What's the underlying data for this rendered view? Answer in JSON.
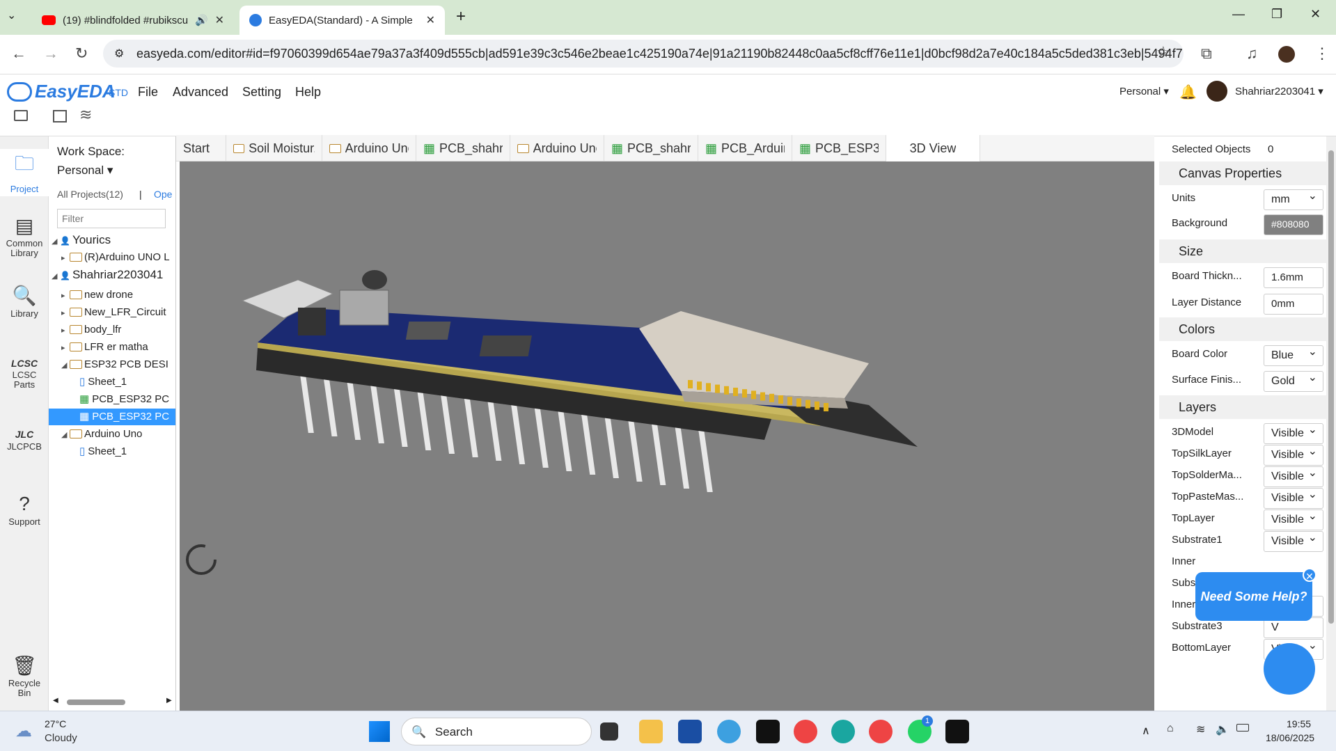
{
  "browser": {
    "tabs": [
      {
        "title": "(19) #blindfolded #rubikscu",
        "active": false
      },
      {
        "title": "EasyEDA(Standard) - A Simple a",
        "active": true
      }
    ],
    "new_tab": "+",
    "url": "easyeda.com/editor#id=f97060399d654ae79a37a3f409d555cb|ad591e39c3c546e2beae1c425190a74e|91a21190b82448c0aa5cf8cff76e11e1|d0bcf98d2a7e40c184a5c5ded381c3eb|5494f7..."
  },
  "app": {
    "logo": "EasyEDA",
    "logo_suffix": "STD",
    "menu": [
      "File",
      "Advanced",
      "Setting",
      "Help"
    ],
    "workspace_menu": "Personal",
    "username": "Shahriar2203041"
  },
  "leftbar": [
    "Project",
    "Common Library",
    "Library",
    "LCSC Parts",
    "JLCPCB",
    "Support",
    "Recycle Bin"
  ],
  "project_panel": {
    "workspace_label": "Work Space:",
    "workspace_value": "Personal",
    "all_projects": "All Projects(12)",
    "open_link": "Ope",
    "filter_placeholder": "Filter",
    "tree": [
      {
        "label": "Yourics",
        "kind": "user",
        "indent": 0
      },
      {
        "label": "(R)Arduino UNO L",
        "kind": "folder",
        "indent": 1
      },
      {
        "label": "Shahriar2203041",
        "kind": "user",
        "indent": 0
      },
      {
        "label": "new drone",
        "kind": "folder",
        "indent": 1
      },
      {
        "label": "New_LFR_Circuit",
        "kind": "folder",
        "indent": 1
      },
      {
        "label": "body_lfr",
        "kind": "folder",
        "indent": 1
      },
      {
        "label": "LFR er matha",
        "kind": "folder",
        "indent": 1
      },
      {
        "label": "ESP32 PCB DESI",
        "kind": "folder-open",
        "indent": 1
      },
      {
        "label": "Sheet_1",
        "kind": "sheet",
        "indent": 2
      },
      {
        "label": "PCB_ESP32 PC",
        "kind": "pcb",
        "indent": 2
      },
      {
        "label": "PCB_ESP32 PC",
        "kind": "pcb-selected",
        "indent": 2
      },
      {
        "label": "Arduino Uno",
        "kind": "folder-open",
        "indent": 1
      },
      {
        "label": "Sheet_1",
        "kind": "sheet",
        "indent": 2
      }
    ]
  },
  "doc_tabs": [
    "Start",
    "Soil Moistur...",
    "Arduino Uno",
    "PCB_shahri...",
    "Arduino Uno",
    "PCB_shahri...",
    "PCB_Arduin...",
    "PCB_ESP32...",
    "3D View"
  ],
  "right_panel": {
    "selected_label": "Selected Objects",
    "selected_count": "0",
    "canvas_props": "Canvas Properties",
    "units_label": "Units",
    "units": "mm",
    "background_label": "Background",
    "background": "#808080",
    "size": "Size",
    "thickness_label": "Board Thickn...",
    "thickness": "1.6mm",
    "layer_distance_label": "Layer Distance",
    "layer_distance": "0mm",
    "colors": "Colors",
    "board_color_label": "Board Color",
    "board_color": "Blue",
    "surface_label": "Surface Finis...",
    "surface": "Gold",
    "layers": "Layers",
    "layer_rows": [
      {
        "name": "3DModel",
        "value": "Visible"
      },
      {
        "name": "TopSilkLayer",
        "value": "Visible"
      },
      {
        "name": "TopSolderMa...",
        "value": "Visible"
      },
      {
        "name": "TopPasteMas...",
        "value": "Visible"
      },
      {
        "name": "TopLayer",
        "value": "Visible"
      },
      {
        "name": "Substrate1",
        "value": "Visible"
      },
      {
        "name": "Inner",
        "value": ""
      },
      {
        "name": "Subs",
        "value": ""
      },
      {
        "name": "Inner2",
        "value": "Visi"
      },
      {
        "name": "Substrate3",
        "value": "V"
      },
      {
        "name": "BottomLayer",
        "value": "Visible"
      }
    ]
  },
  "help_bubble": "Need Some Help?",
  "taskbar": {
    "temp": "27°C",
    "weather": "Cloudy",
    "search": "Search",
    "time": "19:55",
    "date": "18/06/2025",
    "whatsapp_badge": "1"
  },
  "colors": {
    "accent": "#1e88e5",
    "canvas_bg": "#808080",
    "pcb_blue": "#1a2a6c",
    "selected": "#3399ff"
  }
}
